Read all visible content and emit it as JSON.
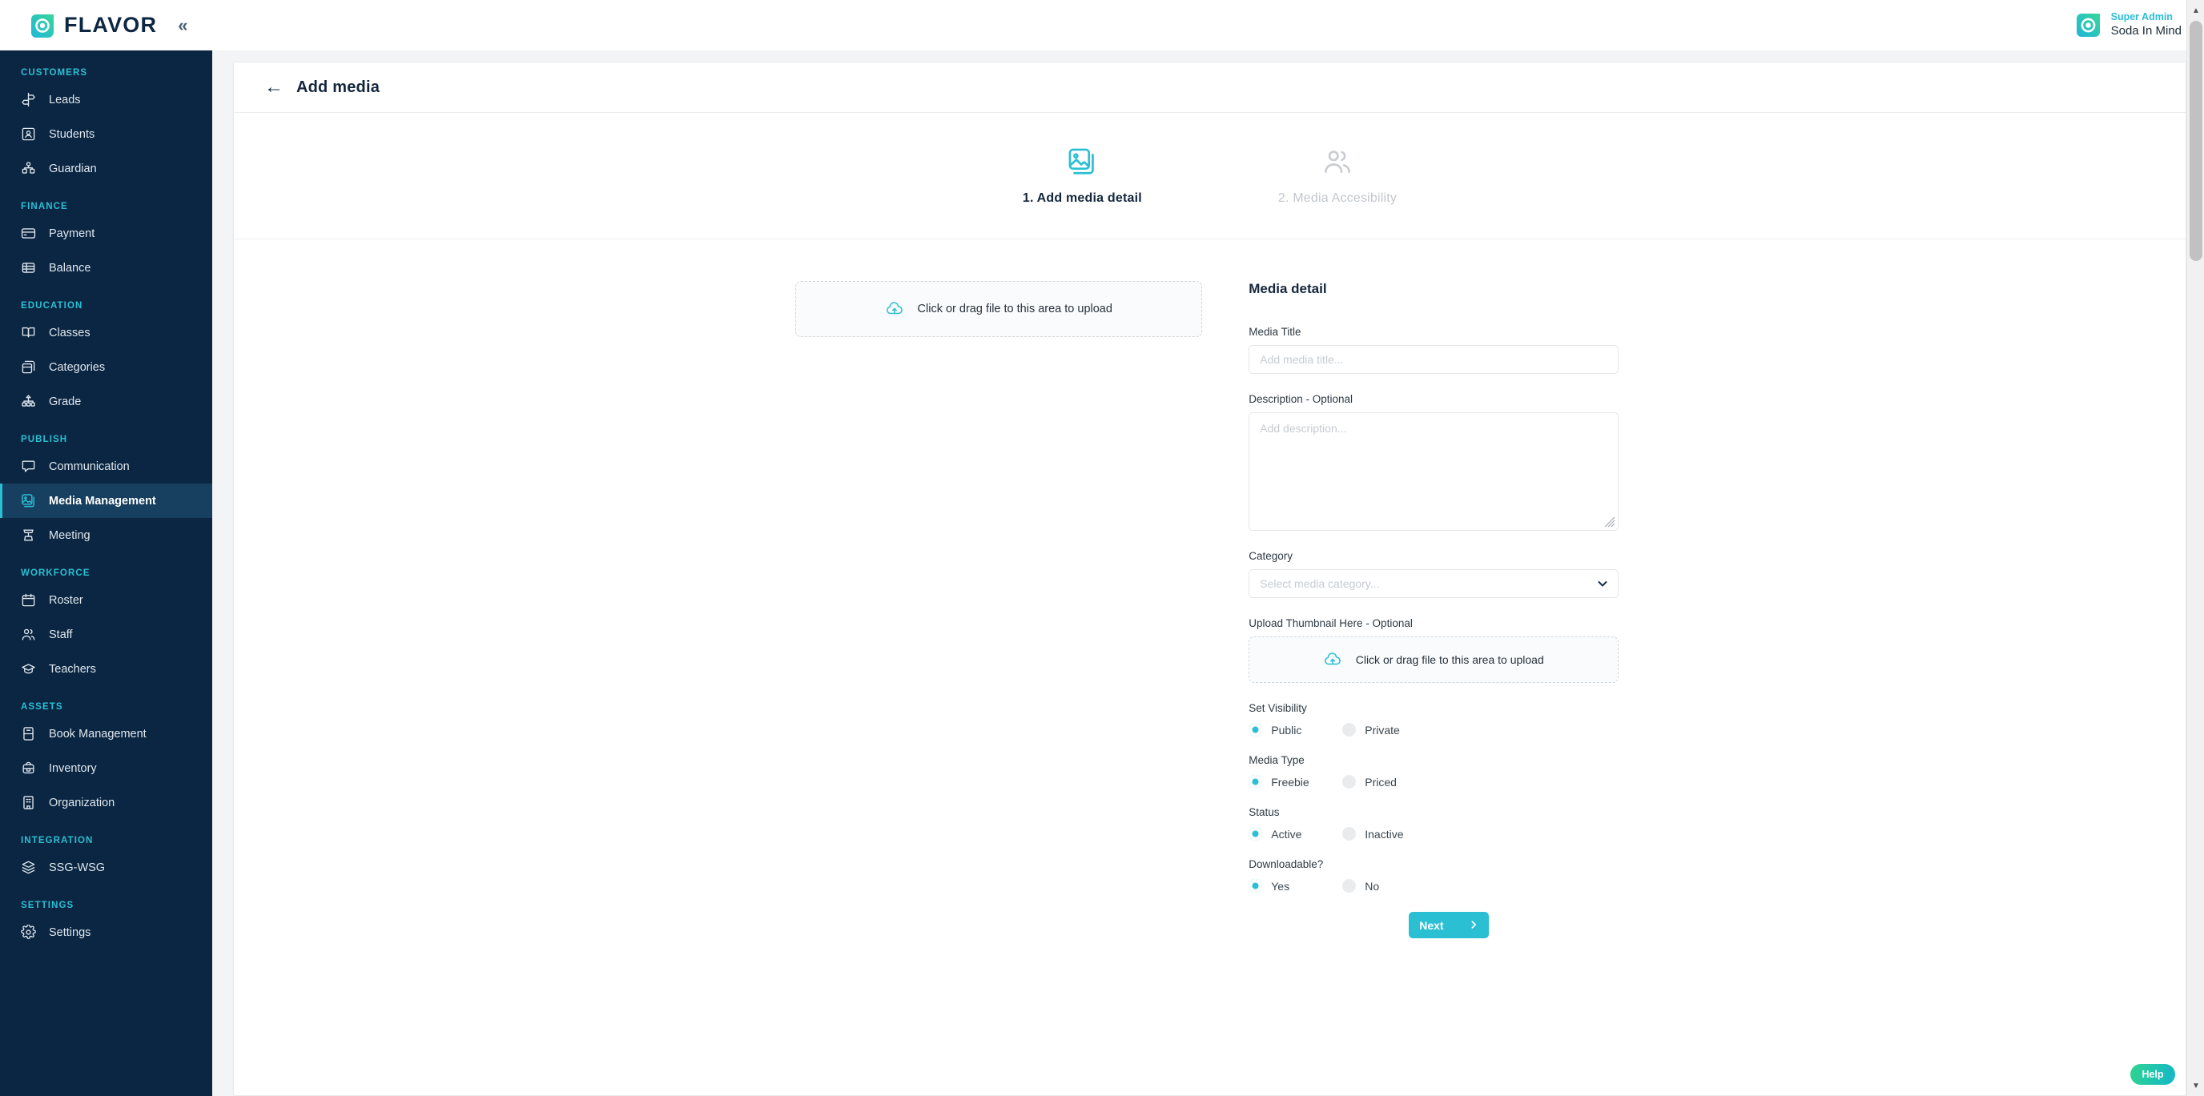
{
  "brand": {
    "logo_text": "FLAVOR",
    "logo_icon": "flavor-circle-logo",
    "accent": "#2bbfd4",
    "sidebar_bg": "#0b2642",
    "sidebar_active_bg": "#173f5f"
  },
  "sidebar": {
    "collapse_icon": "«",
    "sections": [
      {
        "label": "CUSTOMERS",
        "items": [
          {
            "label": "Leads",
            "icon": "signpost-icon",
            "active": false
          },
          {
            "label": "Students",
            "icon": "student-badge-icon",
            "active": false
          },
          {
            "label": "Guardian",
            "icon": "guardian-hierarchy-icon",
            "active": false
          }
        ]
      },
      {
        "label": "FINANCE",
        "items": [
          {
            "label": "Payment",
            "icon": "credit-card-icon",
            "active": false
          },
          {
            "label": "Balance",
            "icon": "stacked-money-icon",
            "active": false
          }
        ]
      },
      {
        "label": "EDUCATION",
        "items": [
          {
            "label": "Classes",
            "icon": "open-book-icon",
            "active": false
          },
          {
            "label": "Categories",
            "icon": "boxes-icon",
            "active": false
          },
          {
            "label": "Grade",
            "icon": "org-tree-icon",
            "active": false
          }
        ]
      },
      {
        "label": "PUBLISH",
        "items": [
          {
            "label": "Communication",
            "icon": "chat-bubble-icon",
            "active": false
          },
          {
            "label": "Media Management",
            "icon": "media-image-icon",
            "active": true
          },
          {
            "label": "Meeting",
            "icon": "podium-icon",
            "active": false
          }
        ]
      },
      {
        "label": "WORKFORCE",
        "items": [
          {
            "label": "Roster",
            "icon": "calendar-icon",
            "active": false
          },
          {
            "label": "Staff",
            "icon": "people-icon",
            "active": false
          },
          {
            "label": "Teachers",
            "icon": "graduation-cap-icon",
            "active": false
          }
        ]
      },
      {
        "label": "ASSETS",
        "items": [
          {
            "label": "Book Management",
            "icon": "book-icon",
            "active": false
          },
          {
            "label": "Inventory",
            "icon": "backpack-icon",
            "active": false
          },
          {
            "label": "Organization",
            "icon": "building-icon",
            "active": false
          }
        ]
      },
      {
        "label": "INTEGRATION",
        "items": [
          {
            "label": "SSG-WSG",
            "icon": "layers-icon",
            "active": false
          }
        ]
      },
      {
        "label": "SETTINGS",
        "items": [
          {
            "label": "Settings",
            "icon": "gear-icon",
            "active": false
          }
        ]
      }
    ]
  },
  "topbar": {
    "user_role": "Super Admin",
    "user_name": "Soda In Mind",
    "avatar_icon": "user-avatar-logo"
  },
  "page": {
    "back_icon": "back-arrow-icon",
    "title": "Add media"
  },
  "stepper": {
    "steps": [
      {
        "label": "1. Add media detail",
        "icon": "image-stack-icon",
        "active": true
      },
      {
        "label": "2. Media Accesibility",
        "icon": "people-icon",
        "active": false
      }
    ]
  },
  "upload": {
    "main_dropzone_text": "Click or drag file to this area to upload",
    "upload_icon": "cloud-upload-icon"
  },
  "form": {
    "title": "Media detail",
    "media_title": {
      "label": "Media Title",
      "placeholder": "Add media title...",
      "value": ""
    },
    "description": {
      "label": "Description - Optional",
      "placeholder": "Add description...",
      "value": ""
    },
    "category": {
      "label": "Category",
      "placeholder": "Select media category...",
      "value": "",
      "chevron_icon": "chevron-down-icon"
    },
    "thumbnail": {
      "label": "Upload Thumbnail Here - Optional",
      "dropzone_text": "Click or drag file to this area to upload",
      "upload_icon": "cloud-upload-icon"
    },
    "radio_groups": [
      {
        "label": "Set Visibility",
        "options": [
          {
            "label": "Public",
            "selected": true
          },
          {
            "label": "Private",
            "selected": false
          }
        ]
      },
      {
        "label": "Media Type",
        "options": [
          {
            "label": "Freebie",
            "selected": true
          },
          {
            "label": "Priced",
            "selected": false
          }
        ]
      },
      {
        "label": "Status",
        "options": [
          {
            "label": "Active",
            "selected": true
          },
          {
            "label": "Inactive",
            "selected": false
          }
        ]
      },
      {
        "label": "Downloadable?",
        "options": [
          {
            "label": "Yes",
            "selected": true
          },
          {
            "label": "No",
            "selected": false
          }
        ]
      }
    ],
    "next_button": {
      "label": "Next",
      "icon": "chevron-right-icon"
    }
  },
  "help": {
    "label": "Help"
  }
}
